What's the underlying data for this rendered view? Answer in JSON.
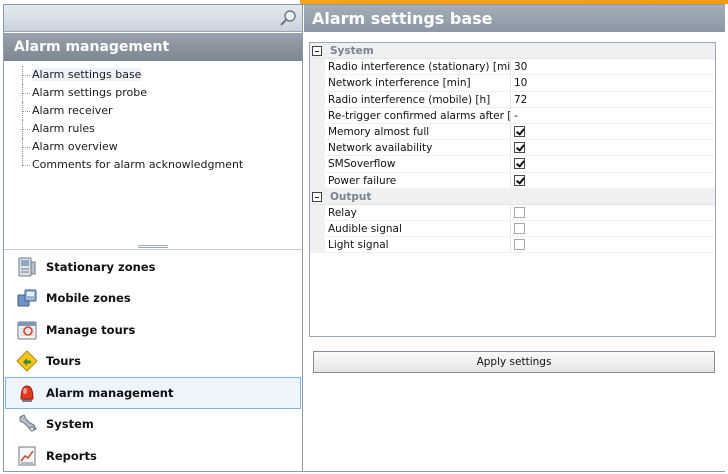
{
  "left": {
    "title": "Alarm management",
    "tree": [
      "Alarm settings base",
      "Alarm settings probe",
      "Alarm receiver",
      "Alarm rules",
      "Alarm overview",
      "Comments for alarm acknowledgment"
    ],
    "nav": [
      {
        "label": "Stationary zones",
        "icon": "stationary-zones-icon"
      },
      {
        "label": "Mobile zones",
        "icon": "mobile-zones-icon"
      },
      {
        "label": "Manage tours",
        "icon": "manage-tours-icon"
      },
      {
        "label": "Tours",
        "icon": "tours-icon"
      },
      {
        "label": "Alarm management",
        "icon": "alarm-icon"
      },
      {
        "label": "System",
        "icon": "system-icon"
      },
      {
        "label": "Reports",
        "icon": "reports-icon"
      }
    ]
  },
  "right": {
    "title": "Alarm settings base",
    "categories": [
      {
        "name": "System",
        "rows": [
          {
            "name": "Radio interference (stationary) [min",
            "value": "30"
          },
          {
            "name": "Network interference [min]",
            "value": "10"
          },
          {
            "name": "Radio interference (mobile) [h]",
            "value": "72"
          },
          {
            "name": "Re-trigger confirmed alarms after [r",
            "value": "-"
          },
          {
            "name": "Memory almost full",
            "checked": true
          },
          {
            "name": "Network availability",
            "checked": true
          },
          {
            "name": "SMSoverflow",
            "checked": true
          },
          {
            "name": "Power failure",
            "checked": true
          }
        ]
      },
      {
        "name": "Output",
        "rows": [
          {
            "name": "Relay",
            "checked": false
          },
          {
            "name": "Audible signal",
            "checked": false
          },
          {
            "name": "Light signal",
            "checked": false
          }
        ]
      }
    ],
    "apply_label": "Apply settings"
  },
  "colors": {
    "accent_orange": "#f7a21b",
    "selection_border": "#7eb4ea",
    "selection_fill": "#eef5fd",
    "header_gray": "#8c97a3"
  }
}
